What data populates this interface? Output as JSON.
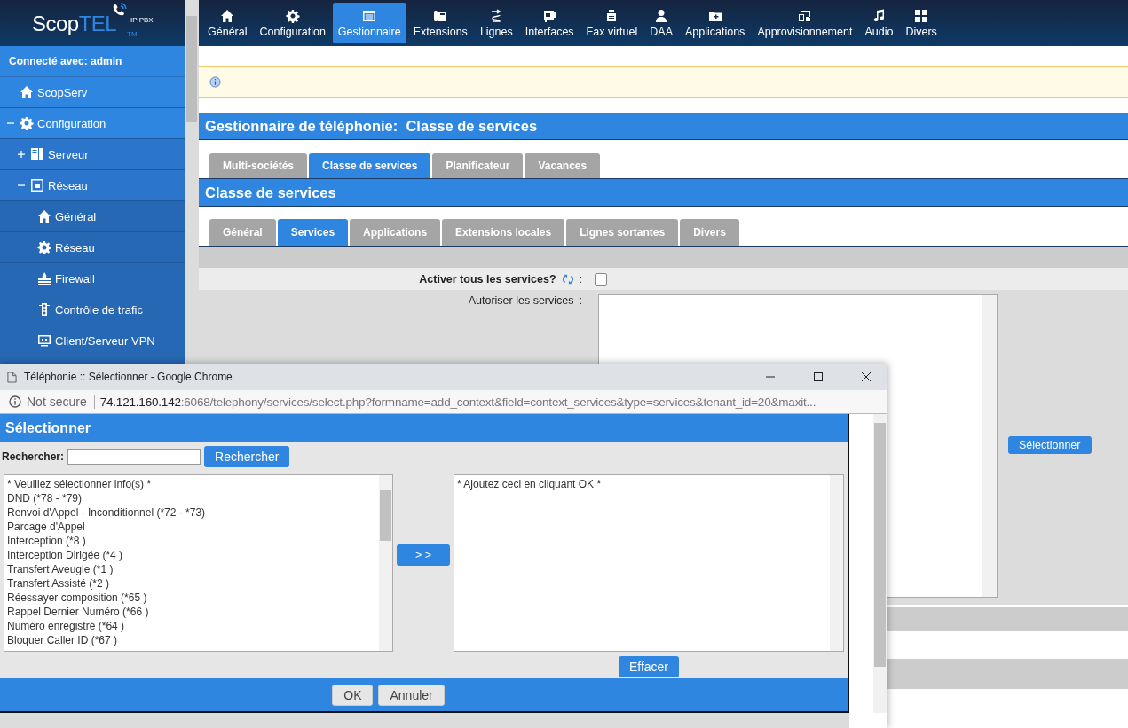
{
  "logo": {
    "name": "Scop",
    "accent": "TEL",
    "trademark": "TM",
    "tagline": "IP PBX"
  },
  "top_nav": [
    {
      "label": "Général",
      "selected": false
    },
    {
      "label": "Configuration",
      "selected": false
    },
    {
      "label": "Gestionnaire",
      "selected": true
    },
    {
      "label": "Extensions",
      "selected": false
    },
    {
      "label": "Lignes",
      "selected": false
    },
    {
      "label": "Interfaces",
      "selected": false
    },
    {
      "label": "Fax virtuel",
      "selected": false
    },
    {
      "label": "DAA",
      "selected": false
    },
    {
      "label": "Applications",
      "selected": false
    },
    {
      "label": "Approvisionnement",
      "selected": false
    },
    {
      "label": "Audio",
      "selected": false
    },
    {
      "label": "Divers",
      "selected": false
    }
  ],
  "sidebar": {
    "user": "Connecté avec: admin",
    "items": [
      {
        "label": "ScopServ"
      },
      {
        "label": "Configuration",
        "expanded": true,
        "children": [
          {
            "label": "Serveur",
            "expanded": false
          },
          {
            "label": "Réseau",
            "expanded": true,
            "children": [
              {
                "label": "Général"
              },
              {
                "label": "Réseau"
              },
              {
                "label": "Firewall"
              },
              {
                "label": "Contrôle de trafic"
              },
              {
                "label": "Client/Serveur VPN"
              }
            ]
          }
        ]
      }
    ]
  },
  "page_title": "Gestionnaire de téléphonie:  Classe de services",
  "tabs": [
    {
      "label": "Multi-sociétés",
      "selected": false
    },
    {
      "label": "Classe de services",
      "selected": true
    },
    {
      "label": "Planificateur",
      "selected": false
    },
    {
      "label": "Vacances",
      "selected": false
    }
  ],
  "section_title": "Classe de services",
  "subtabs": [
    {
      "label": "Général",
      "selected": false
    },
    {
      "label": "Services",
      "selected": true
    },
    {
      "label": "Applications",
      "selected": false
    },
    {
      "label": "Extensions locales",
      "selected": false
    },
    {
      "label": "Lignes sortantes",
      "selected": false
    },
    {
      "label": "Divers",
      "selected": false
    }
  ],
  "form": {
    "activate_all": {
      "label": "Activer tous les services?",
      "separator": ":",
      "checked": false
    },
    "allow_services": {
      "label": "Autoriser les services",
      "separator": ":"
    },
    "select_button": "Sélectionner"
  },
  "popup": {
    "title": "Téléphonie :: Sélectionner - Google Chrome",
    "security": "Not secure",
    "url_host": "74.121.160.142",
    "url_rest": ":6068/telephony/services/select.php?formname=add_context&field=context_services&type=services&tenant_id=20&maxit...",
    "header": "Sélectionner",
    "search_label": "Rechercher:",
    "search_button": "Rechercher",
    "available": [
      "* Veuillez sélectionner info(s) *",
      "DND (*78 - *79)",
      "Renvoi d'Appel - Inconditionnel (*72 - *73)",
      "Parcage d'Appel",
      "Interception (*8 )",
      "Interception Dirigée (*4 )",
      "Transfert Aveugle (*1 )",
      "Transfert Assisté (*2 )",
      "Réessayer composition (*65 )",
      "Rappel Dernier Numéro (*66 )",
      "Numéro enregistré (*64 )",
      "Bloquer Caller ID (*67 )"
    ],
    "move_button": "> >",
    "chosen": [
      "* Ajoutez ceci en cliquant OK *"
    ],
    "clear_button": "Effacer",
    "ok_button": "OK",
    "cancel_button": "Annuler"
  }
}
